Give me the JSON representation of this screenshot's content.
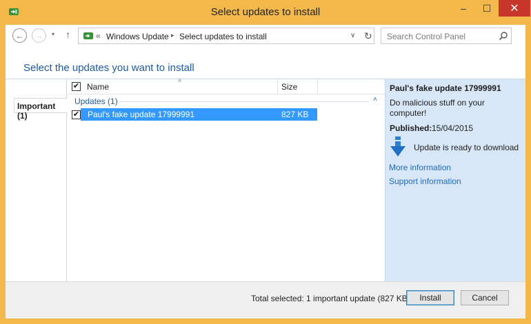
{
  "window": {
    "title": "Select updates to install",
    "controls": {
      "minimize": "–",
      "maximize": "☐",
      "close": "✕"
    },
    "frame_color": "#f2b84b"
  },
  "navigation": {
    "back": "←",
    "forward": "→",
    "recent": "▾",
    "up": "↑",
    "address": {
      "chevron": "«",
      "crumbs": [
        "Windows Update",
        "Select updates to install"
      ],
      "separator": "▸",
      "dropdown": "∨",
      "refresh": "↻"
    },
    "search": {
      "placeholder": "Search Control Panel"
    }
  },
  "heading": "Select the updates you want to install",
  "categories": [
    {
      "label": "Important (1)",
      "selected": true
    }
  ],
  "list": {
    "columns": {
      "name": "Name",
      "size": "Size"
    },
    "select_all_checked": "✔",
    "group": {
      "label": "Updates (1)",
      "collapse": "˄"
    },
    "rows": [
      {
        "checked": "✔",
        "name": "Paul's fake update 17999991",
        "size": "827 KB",
        "selected": true
      }
    ]
  },
  "details": {
    "title": "Paul's fake update 17999991",
    "description": "Do malicious stuff on your computer!",
    "published_label": "Published:",
    "published_value": "15/04/2015",
    "status": "Update is ready to download",
    "links": {
      "more": "More information",
      "support": "Support information"
    },
    "background": "#d7e7f7"
  },
  "footer": {
    "total": "Total selected: 1 important update (827 KB)",
    "install": "Install",
    "cancel": "Cancel"
  },
  "icons": {
    "app": "windows-update-icon",
    "download": "download-arrow-icon",
    "search": "search-icon"
  },
  "colors": {
    "accent": "#1e5aa8",
    "selection": "#3399ff",
    "link": "#1e6ac4",
    "close": "#c7362b"
  }
}
